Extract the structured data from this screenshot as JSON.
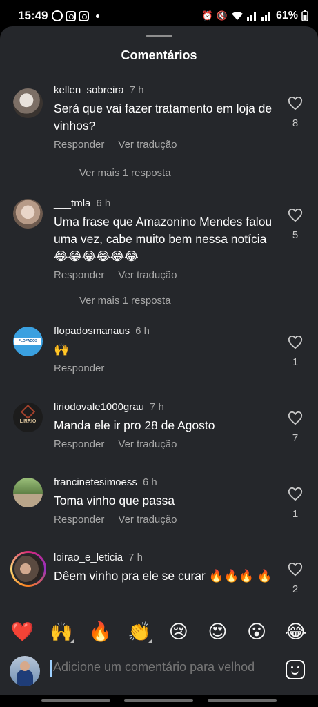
{
  "status": {
    "time": "15:49",
    "battery": "61%"
  },
  "sheet": {
    "title": "Comentários"
  },
  "comments": [
    {
      "user": "kellen_sobreira",
      "time": "7 h",
      "text": "Será que vai fazer tratamento em loja de vinhos?",
      "reply": "Responder",
      "translate": "Ver tradução",
      "likes": "8",
      "more_replies": "Ver mais 1 resposta"
    },
    {
      "user": "___tmla",
      "time": "6 h",
      "text": "Uma frase que Amazonino Mendes falou uma vez, cabe muito bem nessa notícia 😂😂😂😂😂😂",
      "reply": "Responder",
      "translate": "Ver tradução",
      "likes": "5",
      "more_replies": "Ver mais 1 resposta"
    },
    {
      "user": "flopadosmanaus",
      "time": "6 h",
      "text": "🙌",
      "reply": "Responder",
      "likes": "1",
      "avatar_text": "FLOPADOS MANAUS"
    },
    {
      "user": "liriodovale1000grau",
      "time": "7 h",
      "text": "Manda ele ir pro 28 de Agosto",
      "reply": "Responder",
      "translate": "Ver tradução",
      "likes": "7",
      "avatar_text": "LIRRIO"
    },
    {
      "user": "francinetesimoess",
      "time": "6 h",
      "text": "Toma vinho que passa",
      "reply": "Responder",
      "translate": "Ver tradução",
      "likes": "1"
    },
    {
      "user": "loirao_e_leticia",
      "time": "7 h",
      "text": "Dêem vinho pra ele se curar 🔥🔥🔥 🔥",
      "likes": "2"
    }
  ],
  "emoji_bar": [
    "❤️",
    "🙌",
    "🔥",
    "👏",
    "😢",
    "😍",
    "😮",
    "😂"
  ],
  "composer": {
    "placeholder": "Adicione um comentário para velhod"
  },
  "icons": {
    "like": "heart-outline-icon",
    "sticker": "sticker-icon"
  },
  "colors": {
    "sheet_bg": "#25272b",
    "secondary_text": "#a8a8a8"
  }
}
